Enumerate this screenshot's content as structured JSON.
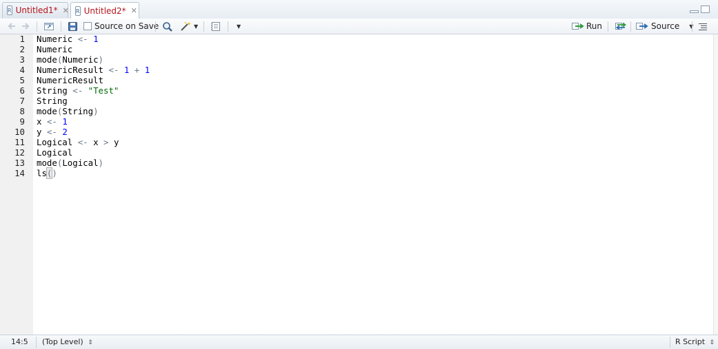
{
  "tabs": [
    {
      "label": "Untitled1*",
      "icon": "r-file-icon",
      "active": false
    },
    {
      "label": "Untitled2*",
      "icon": "r-file-icon",
      "active": true
    }
  ],
  "toolbar": {
    "source_on_save_label": "Source on Save",
    "source_on_save_checked": false,
    "run_label": "Run",
    "source_label": "Source"
  },
  "editor": {
    "lines": [
      {
        "n": "1",
        "tokens": [
          [
            "id",
            "Numeric"
          ],
          [
            "sp",
            " "
          ],
          [
            "op",
            "<-"
          ],
          [
            "sp",
            " "
          ],
          [
            "num",
            "1"
          ]
        ]
      },
      {
        "n": "2",
        "tokens": [
          [
            "id",
            "Numeric"
          ]
        ]
      },
      {
        "n": "3",
        "tokens": [
          [
            "id",
            "mode"
          ],
          [
            "p",
            "("
          ],
          [
            "id",
            "Numeric"
          ],
          [
            "p",
            ")"
          ]
        ]
      },
      {
        "n": "4",
        "tokens": [
          [
            "id",
            "NumericResult"
          ],
          [
            "sp",
            " "
          ],
          [
            "op",
            "<-"
          ],
          [
            "sp",
            " "
          ],
          [
            "num",
            "1"
          ],
          [
            "sp",
            " "
          ],
          [
            "op",
            "+"
          ],
          [
            "sp",
            " "
          ],
          [
            "num",
            "1"
          ]
        ]
      },
      {
        "n": "5",
        "tokens": [
          [
            "id",
            "NumericResult"
          ]
        ]
      },
      {
        "n": "6",
        "tokens": [
          [
            "id",
            "String"
          ],
          [
            "sp",
            " "
          ],
          [
            "op",
            "<-"
          ],
          [
            "sp",
            " "
          ],
          [
            "str",
            "\"Test\""
          ]
        ]
      },
      {
        "n": "7",
        "tokens": [
          [
            "id",
            "String"
          ]
        ]
      },
      {
        "n": "8",
        "tokens": [
          [
            "id",
            "mode"
          ],
          [
            "p",
            "("
          ],
          [
            "id",
            "String"
          ],
          [
            "p",
            ")"
          ]
        ]
      },
      {
        "n": "9",
        "tokens": [
          [
            "id",
            "x"
          ],
          [
            "sp",
            " "
          ],
          [
            "op",
            "<-"
          ],
          [
            "sp",
            " "
          ],
          [
            "num",
            "1"
          ]
        ]
      },
      {
        "n": "10",
        "tokens": [
          [
            "id",
            "y"
          ],
          [
            "sp",
            " "
          ],
          [
            "op",
            "<-"
          ],
          [
            "sp",
            " "
          ],
          [
            "num",
            "2"
          ]
        ]
      },
      {
        "n": "11",
        "tokens": [
          [
            "id",
            "Logical"
          ],
          [
            "sp",
            " "
          ],
          [
            "op",
            "<-"
          ],
          [
            "sp",
            " "
          ],
          [
            "id",
            "x"
          ],
          [
            "sp",
            " "
          ],
          [
            "op",
            ">"
          ],
          [
            "sp",
            " "
          ],
          [
            "id",
            "y"
          ]
        ]
      },
      {
        "n": "12",
        "tokens": [
          [
            "id",
            "Logical"
          ]
        ]
      },
      {
        "n": "13",
        "tokens": [
          [
            "id",
            "mode"
          ],
          [
            "p",
            "("
          ],
          [
            "id",
            "Logical"
          ],
          [
            "p",
            ")"
          ]
        ]
      },
      {
        "n": "14",
        "tokens": [
          [
            "id",
            "ls"
          ],
          [
            "phl",
            "("
          ],
          [
            "p",
            ")"
          ]
        ]
      }
    ]
  },
  "status": {
    "cursor": "14:5",
    "scope": "(Top Level)",
    "filetype": "R Script"
  },
  "colors": {
    "number": "#0000ff",
    "string": "#036a07",
    "operator": "#687687",
    "tab_modified": "#b4141b"
  }
}
